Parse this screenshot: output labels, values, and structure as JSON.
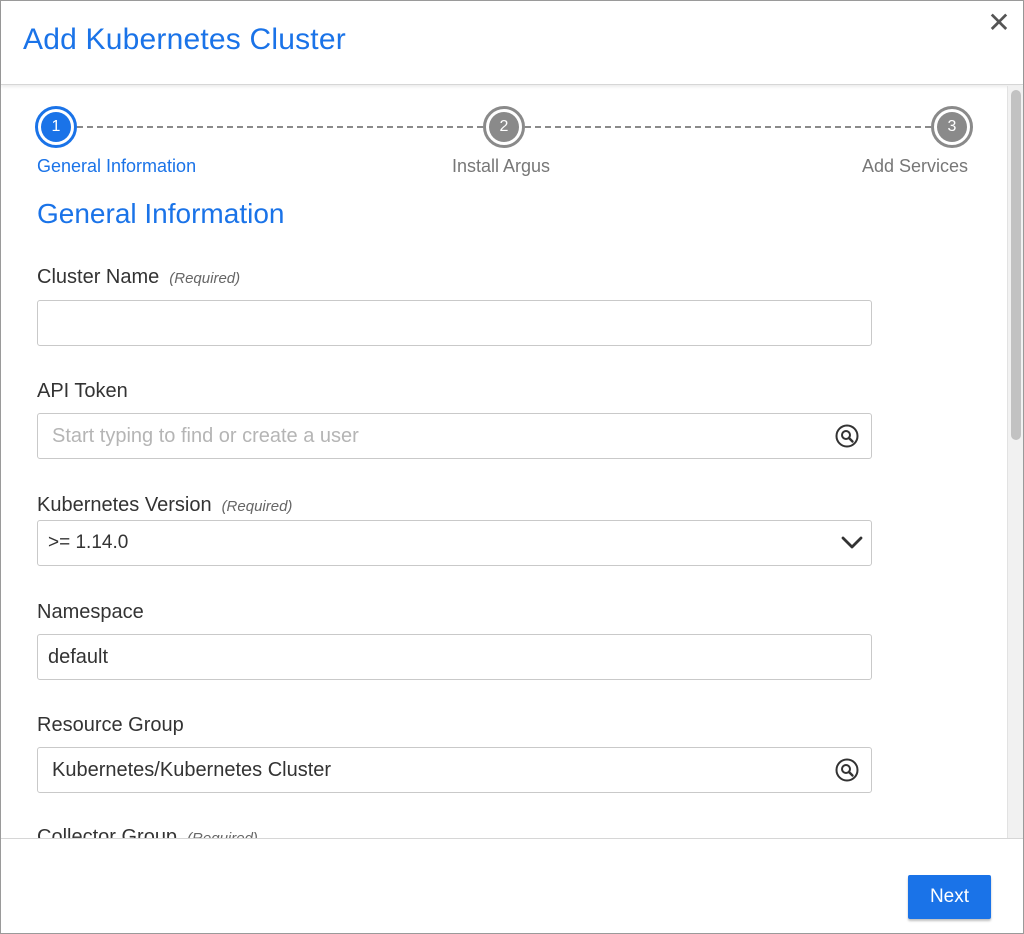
{
  "dialog": {
    "title": "Add Kubernetes Cluster",
    "close_glyph": "✕"
  },
  "stepper": {
    "steps": [
      {
        "number": "1",
        "label": "General Information",
        "active": true
      },
      {
        "number": "2",
        "label": "Install Argus",
        "active": false
      },
      {
        "number": "3",
        "label": "Add Services",
        "active": false
      }
    ]
  },
  "form": {
    "section_title": "General Information",
    "required_tag": "(Required)",
    "cluster_name": {
      "label": "Cluster Name",
      "value": ""
    },
    "api_token": {
      "label": "API Token",
      "placeholder": "Start typing to find or create a user",
      "icon": "search-icon"
    },
    "kubernetes_version": {
      "label": "Kubernetes Version",
      "value": ">= 1.14.0",
      "icon": "chevron-down-icon"
    },
    "namespace": {
      "label": "Namespace",
      "value": "default"
    },
    "resource_group": {
      "label": "Resource Group",
      "value": "Kubernetes/Kubernetes Cluster",
      "icon": "search-icon"
    },
    "collector_group": {
      "label": "Collector Group"
    }
  },
  "footer": {
    "next_label": "Next"
  },
  "colors": {
    "accent": "#1a73e8",
    "inactive_step": "#8a8a8a"
  }
}
